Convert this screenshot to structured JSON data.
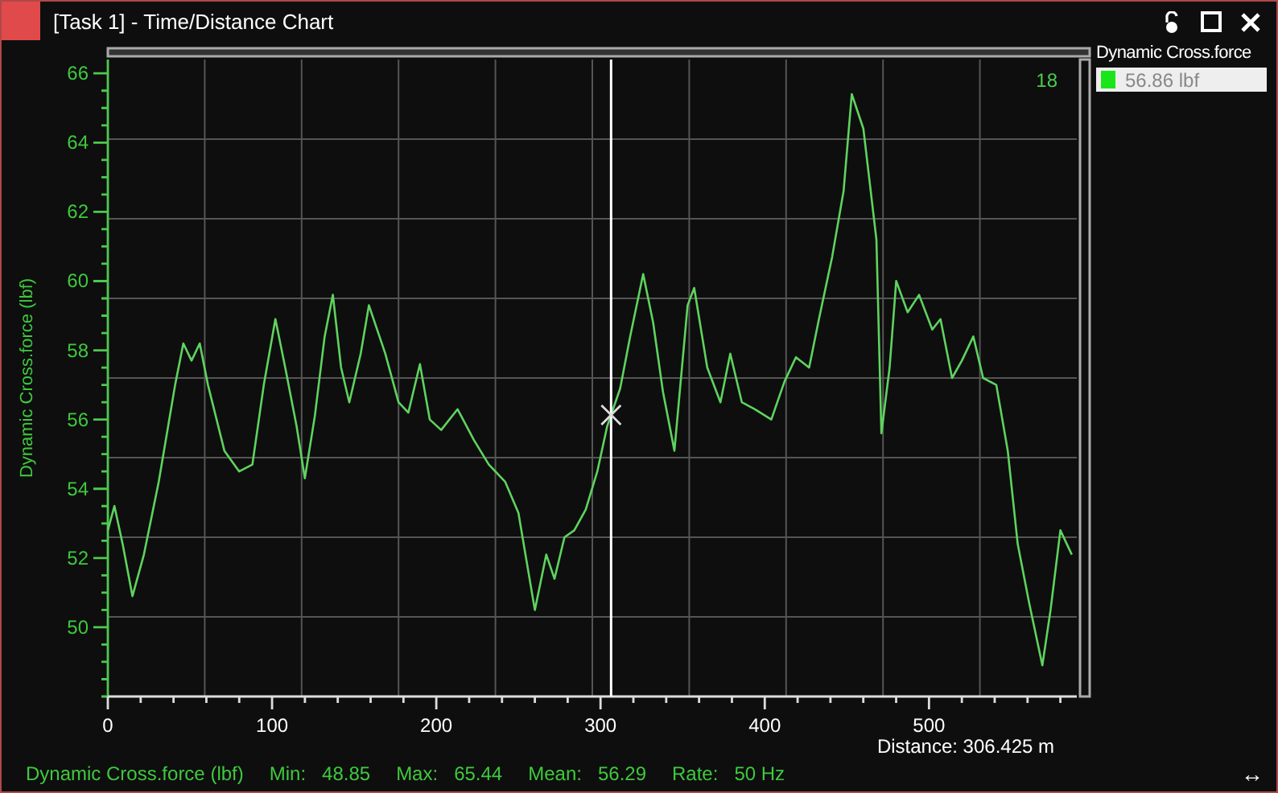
{
  "window": {
    "title": "[Task 1] - Time/Distance Chart"
  },
  "chart": {
    "corner_label": "18",
    "chart_data": {
      "type": "line",
      "ylabel": "Dynamic Cross.force (lbf)",
      "xlim": [
        0,
        590
      ],
      "ylim": [
        48,
        66.4
      ],
      "xticks": [
        0,
        100,
        200,
        300,
        400,
        500
      ],
      "yticks": [
        50,
        52,
        54,
        56,
        58,
        60,
        62,
        64,
        66
      ],
      "x": [
        0,
        4,
        9,
        15,
        22,
        31,
        41,
        46,
        51,
        56,
        61,
        71,
        80,
        88,
        95,
        102,
        108,
        115,
        120,
        126,
        132,
        137,
        142,
        147,
        154,
        159,
        169,
        177,
        183,
        190,
        196,
        203,
        213,
        223,
        232,
        242,
        250,
        255,
        260,
        267,
        272,
        278,
        284,
        291,
        298,
        304,
        312,
        318,
        326,
        332,
        338,
        345,
        353,
        357,
        365,
        373,
        379,
        386,
        394,
        404,
        412,
        419,
        427,
        433,
        441,
        448,
        453,
        460,
        468,
        471,
        476,
        480,
        487,
        494,
        502,
        507,
        514,
        520,
        527,
        533,
        541,
        548,
        554,
        561,
        569,
        574,
        580,
        587
      ],
      "series": [
        {
          "name": "Dynamic Cross.force",
          "color": "#5fd35f",
          "values": [
            52.8,
            53.5,
            52.4,
            50.9,
            52.1,
            54.2,
            57.0,
            58.2,
            57.7,
            58.2,
            57.0,
            55.1,
            54.5,
            54.7,
            57.0,
            58.9,
            57.5,
            55.8,
            54.3,
            56.1,
            58.4,
            59.6,
            57.5,
            56.5,
            57.9,
            59.3,
            57.9,
            56.5,
            56.2,
            57.6,
            56.0,
            55.7,
            56.3,
            55.4,
            54.7,
            54.2,
            53.3,
            51.9,
            50.5,
            52.1,
            51.4,
            52.6,
            52.8,
            53.4,
            54.5,
            55.8,
            56.9,
            58.4,
            60.2,
            58.8,
            56.8,
            55.1,
            59.3,
            59.8,
            57.5,
            56.5,
            57.9,
            56.5,
            56.3,
            56.0,
            57.1,
            57.8,
            57.5,
            58.9,
            60.7,
            62.6,
            65.4,
            64.4,
            61.2,
            55.6,
            57.5,
            60.0,
            59.1,
            59.6,
            58.6,
            58.9,
            57.2,
            57.7,
            58.4,
            57.2,
            57.0,
            55.1,
            52.4,
            50.7,
            48.9,
            50.5,
            52.8,
            52.1
          ]
        }
      ],
      "ref_lines": [
        {
          "axis": "x",
          "value": 306.425
        }
      ]
    },
    "cursor_label": "Distance: 306.425 m"
  },
  "legend": {
    "items": [
      {
        "value": "56.86 lbf",
        "color": "#19e619"
      }
    ]
  },
  "status_bar": {
    "channel": "Dynamic Cross.force (lbf)",
    "stats": [
      {
        "label": "Min:",
        "value": "48.85"
      },
      {
        "label": "Max:",
        "value": "65.44"
      },
      {
        "label": "Mean:",
        "value": "56.29"
      },
      {
        "label": "Rate:",
        "value": "50 Hz"
      }
    ],
    "resize_glyph": "↔"
  }
}
